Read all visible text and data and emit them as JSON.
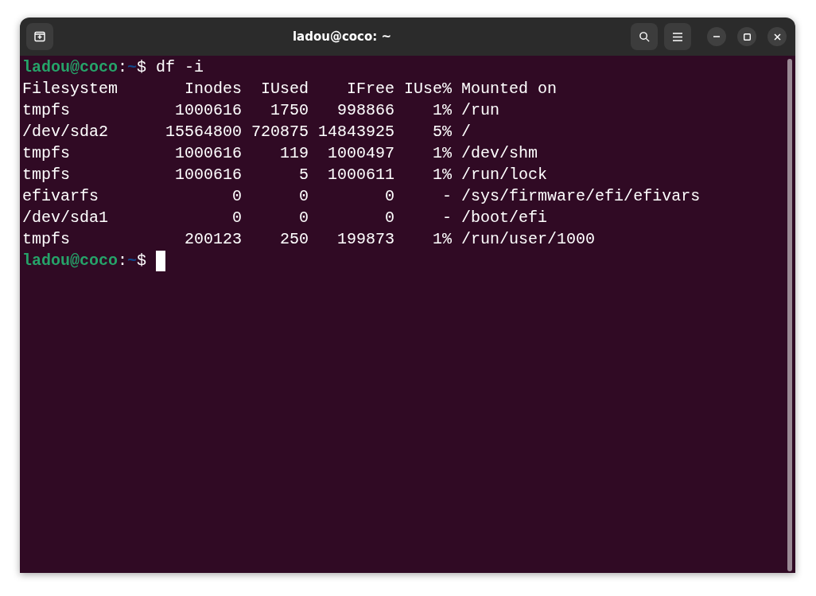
{
  "window": {
    "title": "ladou@coco: ~"
  },
  "terminal": {
    "lines": [
      {
        "kind": "prompt",
        "user_host": "ladou@coco",
        "separator": ":",
        "path": "~",
        "symbol": "$",
        "command": "df -i",
        "cursor": false
      },
      {
        "kind": "output",
        "text": "Filesystem       Inodes  IUsed    IFree IUse% Mounted on"
      },
      {
        "kind": "output",
        "text": "tmpfs           1000616   1750   998866    1% /run"
      },
      {
        "kind": "output",
        "text": "/dev/sda2      15564800 720875 14843925    5% /"
      },
      {
        "kind": "output",
        "text": "tmpfs           1000616    119  1000497    1% /dev/shm"
      },
      {
        "kind": "output",
        "text": "tmpfs           1000616      5  1000611    1% /run/lock"
      },
      {
        "kind": "output",
        "text": "efivarfs              0      0        0     - /sys/firmware/efi/efivars"
      },
      {
        "kind": "output",
        "text": "/dev/sda1             0      0        0     - /boot/efi"
      },
      {
        "kind": "output",
        "text": "tmpfs            200123    250   199873    1% /run/user/1000"
      },
      {
        "kind": "prompt",
        "user_host": "ladou@coco",
        "separator": ":",
        "path": "~",
        "symbol": "$",
        "cursor": true
      }
    ]
  }
}
